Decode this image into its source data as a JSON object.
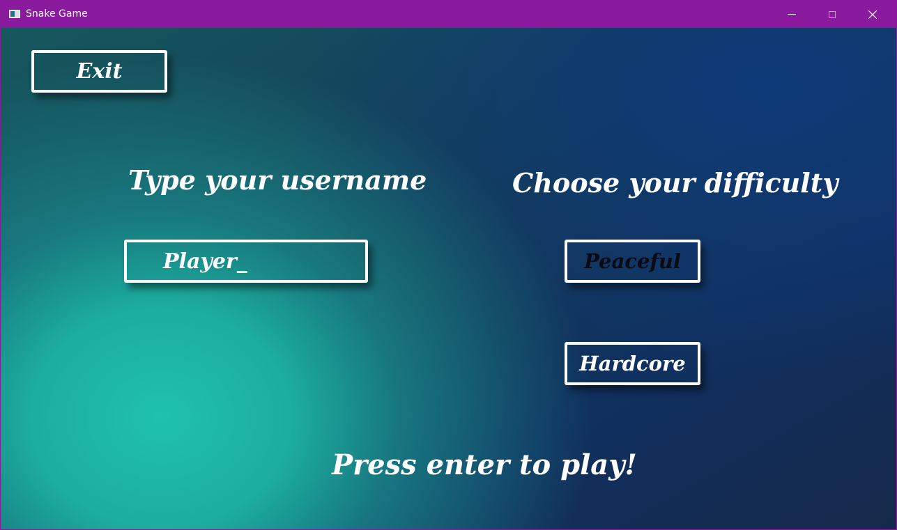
{
  "window": {
    "title": "Snake Game",
    "app_icon": "window-app-icon",
    "controls": [
      "minimize-icon",
      "maximize-icon",
      "close-icon"
    ]
  },
  "menu": {
    "exit_label": "Exit",
    "username_heading": "Type your username",
    "username_value": "Player_",
    "difficulty_heading": "Choose your difficulty",
    "difficulty_options": [
      "Peaceful",
      "Hardcore"
    ],
    "selected_difficulty": "Peaceful",
    "start_prompt": "Press enter to play!"
  },
  "colors": {
    "titlebar": "#8a1a9e",
    "text": "#ffffff",
    "selected_text": "#0a0a14",
    "button_border": "#ffffff"
  }
}
